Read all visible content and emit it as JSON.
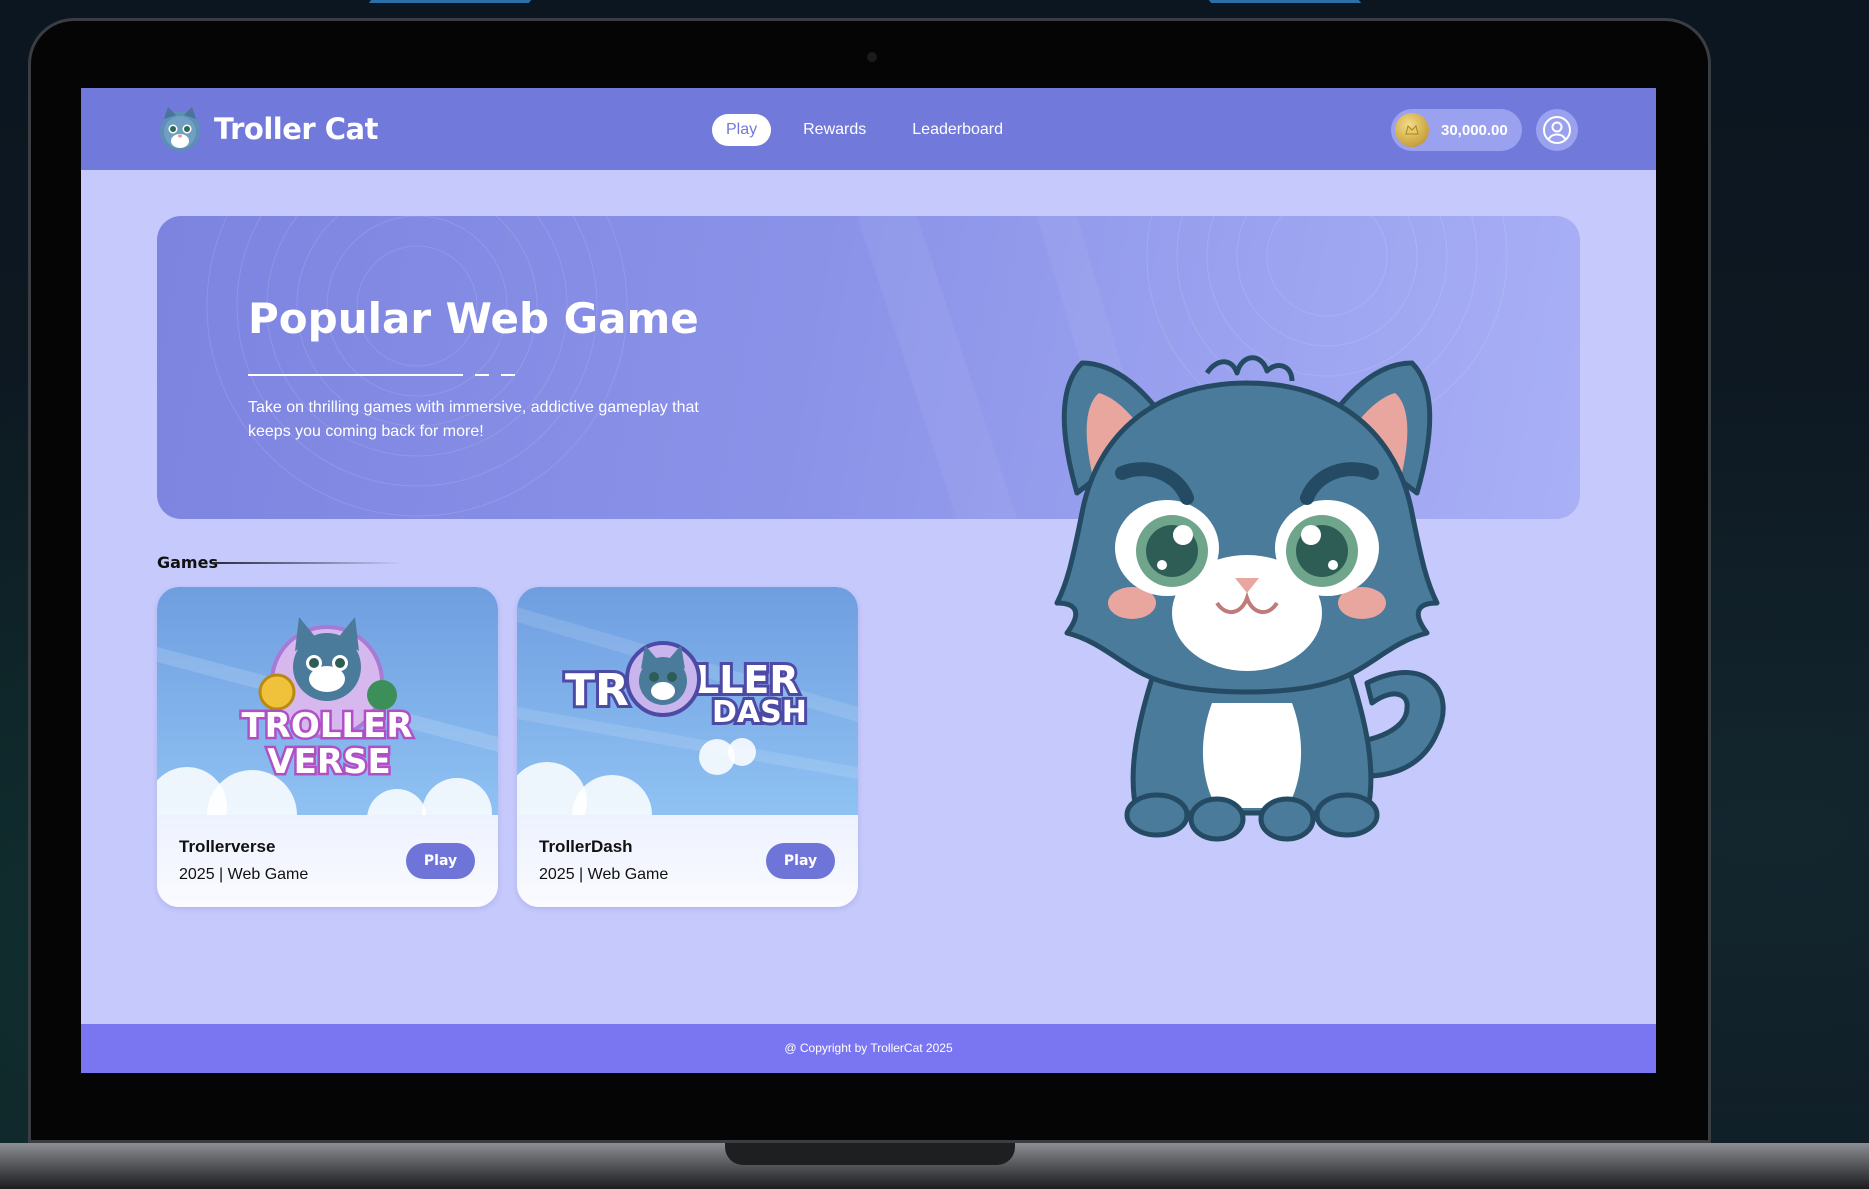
{
  "app": {
    "name": "Troller Cat"
  },
  "nav": {
    "items": [
      {
        "label": "Play"
      },
      {
        "label": "Rewards"
      },
      {
        "label": "Leaderboard"
      }
    ],
    "active": "Play"
  },
  "header": {
    "balance": "30,000.00",
    "icons": [
      "coin-icon",
      "user-profile-icon"
    ]
  },
  "hero": {
    "title": "Popular Web Game",
    "description": "Take on thrilling games with immersive, addictive gameplay that keeps you coming back for more!"
  },
  "games": {
    "section_title": "Games",
    "items": [
      {
        "title": "Trollerverse",
        "subtitle": "2025 | Web Game",
        "button": "Play",
        "logo_line1": "TROLLER",
        "logo_line2": "VERSE"
      },
      {
        "title": "TrollerDash",
        "subtitle": "2025 | Web Game",
        "button": "Play",
        "logo_line1": "TR",
        "logo_line1b": "LLER",
        "logo_line2": "DASH"
      }
    ]
  },
  "footer": {
    "text": "@ Copyright by TrollerCat 2025"
  },
  "colors": {
    "topbar": "#7179da",
    "page": "#c5c9fb",
    "footer": "#7a76f1",
    "accent": "#6e74d8"
  }
}
